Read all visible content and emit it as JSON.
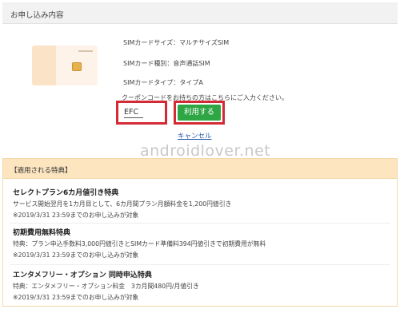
{
  "header": {
    "title": "お申し込み内容"
  },
  "sim": {
    "size_label": "SIMカードサイズ：マルチサイズSIM",
    "kind_label": "SIMカード種別：音声通話SIM",
    "type_label": "SIMカードタイプ：タイプA"
  },
  "coupon": {
    "note": "クーポンコードをお持ちの方はこちらにご入力ください。",
    "value": "EFC",
    "apply_label": "利用する",
    "cancel_label": "キャンセル"
  },
  "watermark": "androidlover.net",
  "benefits": {
    "heading": "【適用される特典】",
    "items": [
      {
        "title": "セレクトプラン6カ月値引き特典",
        "desc": "サービス開始翌月を1カ月目として、6カ月間プラン月額料金を1,200円値引き",
        "note": "※2019/3/31 23:59までのお申し込みが対象"
      },
      {
        "title": "初期費用無料特典",
        "desc": "特典：プラン申込手数料3,000円値引きとSIMカード準備料394円値引きで初期費用が無料",
        "note": "※2019/3/31 23:59までのお申し込みが対象"
      },
      {
        "title": "エンタメフリー・オプション 同時申込特典",
        "desc": "特典：エンタメフリー・オプション料金　3カ月間480円/月値引き",
        "note": "※2019/3/31 23:59までのお申し込みが対象"
      }
    ]
  }
}
